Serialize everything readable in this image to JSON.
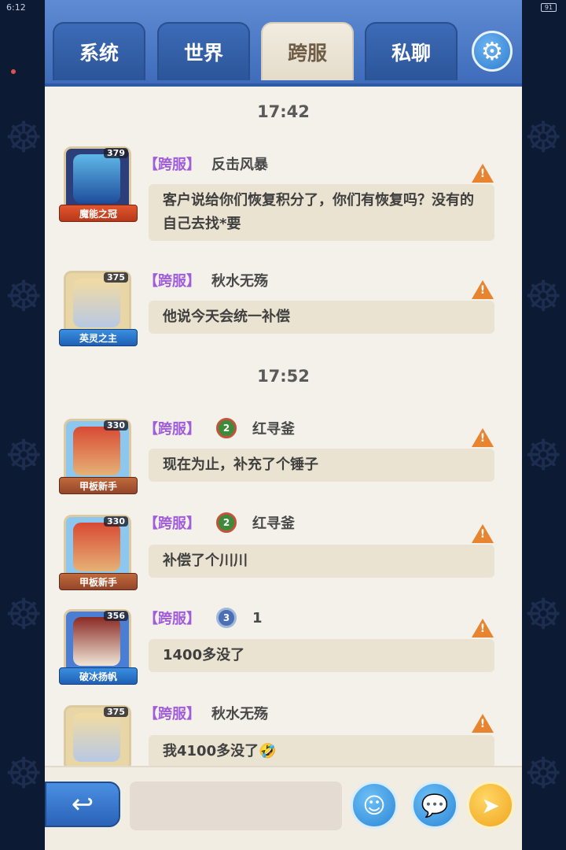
{
  "status_bar": {
    "time": "6:12",
    "battery": "91"
  },
  "tabs": [
    {
      "label": "系统",
      "active": false
    },
    {
      "label": "世界",
      "active": false
    },
    {
      "label": "跨服",
      "active": true
    },
    {
      "label": "私聊",
      "active": false
    }
  ],
  "settings_icon": "gear-icon",
  "timestamps": [
    "17:42",
    "17:52"
  ],
  "messages": [
    {
      "channel": "【跨服】",
      "user": "反击风暴",
      "vip": "",
      "level": "379",
      "title": "魔能之冠",
      "text": "客户说给你们恢复积分了，你们有恢复吗？没有的自己去找*要"
    },
    {
      "channel": "【跨服】",
      "user": "秋水无殇",
      "vip": "",
      "level": "375",
      "title": "英灵之主",
      "text": "他说今天会统一补偿"
    },
    {
      "channel": "【跨服】",
      "user": "红寻釜",
      "vip": "2",
      "level": "330",
      "title": "甲板新手",
      "text": "现在为止，补充了个锤子"
    },
    {
      "channel": "【跨服】",
      "user": "红寻釜",
      "vip": "2",
      "level": "330",
      "title": "甲板新手",
      "text": "补偿了个川川"
    },
    {
      "channel": "【跨服】",
      "user": "1",
      "vip": "3",
      "level": "356",
      "title": "破冰扬帆",
      "text": "1400多没了"
    },
    {
      "channel": "【跨服】",
      "user": "秋水无殇",
      "vip": "",
      "level": "375",
      "title": "",
      "text": "我4100多没了🤣"
    }
  ],
  "bottom_bar": {
    "back_icon": "back-arrow-icon",
    "input_value": "",
    "emoji_icon": "smiley-icon",
    "quick_icon": "speech-bubble-icon",
    "send_icon": "send-icon"
  },
  "colors": {
    "tab_bar": "#4f7cc6",
    "active_tab": "#ebe4d4",
    "channel_tag": "#a05cd9",
    "bubble": "#ebe3d1",
    "warning": "#e8832f"
  }
}
